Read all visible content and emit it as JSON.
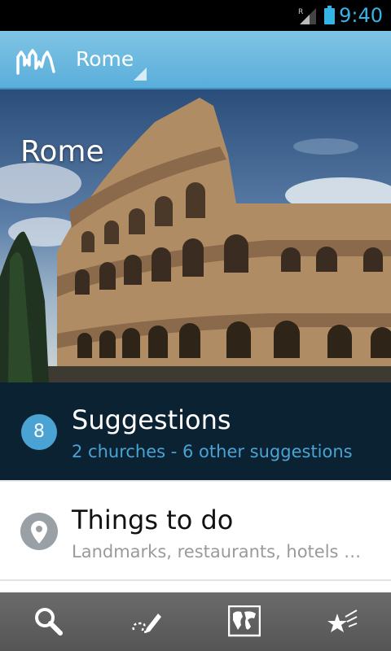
{
  "status_bar": {
    "time": "9:40",
    "roaming_indicator": "R",
    "icons": [
      "signal-icon",
      "battery-icon"
    ],
    "accent_color": "#33b5e5"
  },
  "action_bar": {
    "app_icon": "skyline-logo-icon",
    "title": "Rome",
    "background_color": "#6bb9e0"
  },
  "hero": {
    "image": "colosseum-photo",
    "city_name": "Rome"
  },
  "suggestions": {
    "count": "8",
    "title": "Suggestions",
    "subtitle": "2 churches - 6 other suggestions",
    "accent_color": "#4ba3d3"
  },
  "things_to_do": {
    "icon": "map-pin-icon",
    "title": "Things to do",
    "subtitle": "Landmarks, restaurants, hotels …"
  },
  "toolbar": {
    "buttons": [
      {
        "icon": "search-icon"
      },
      {
        "icon": "edit-route-icon"
      },
      {
        "icon": "world-map-icon",
        "active": true
      },
      {
        "icon": "favorites-stars-icon"
      }
    ]
  }
}
